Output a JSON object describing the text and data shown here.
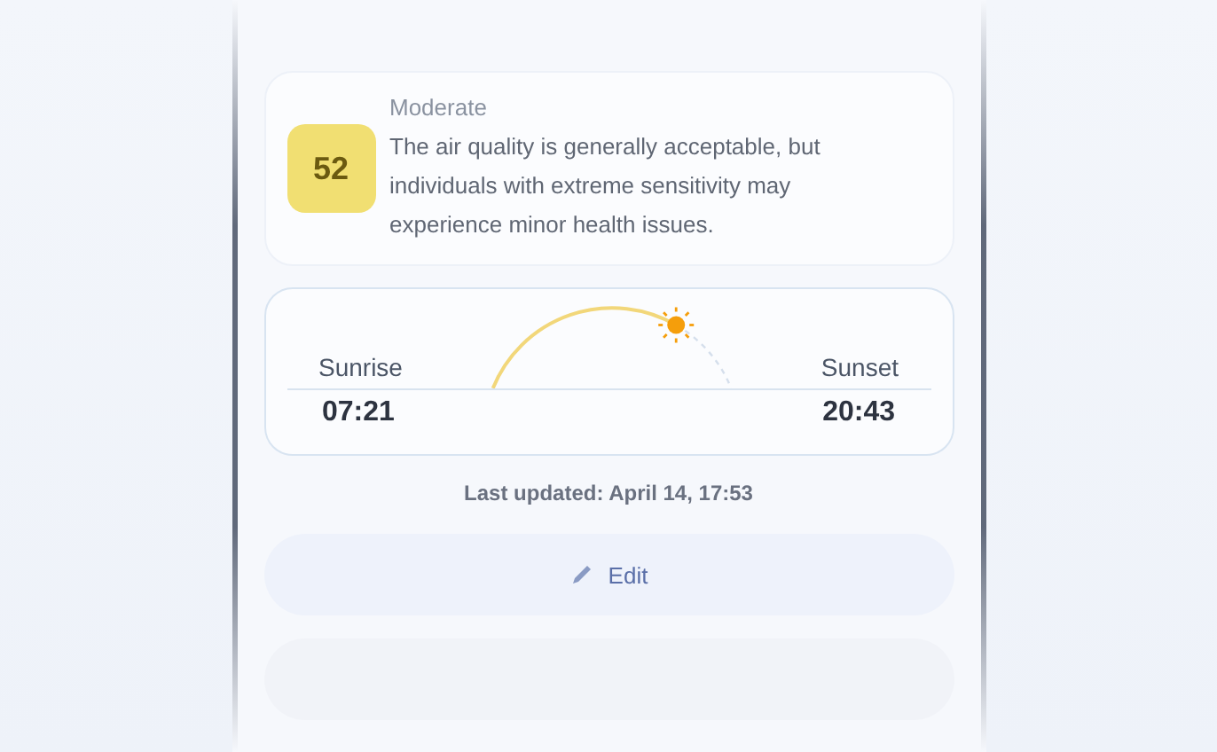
{
  "aqi": {
    "value": "52",
    "category": "Moderate",
    "description": "The air quality is generally acceptable, but individuals with extreme sensitivity may experience minor health issues."
  },
  "sun": {
    "sunrise_label": "Sunrise",
    "sunrise": "07:21",
    "sunset_label": "Sunset",
    "sunset": "20:43",
    "level": 0.72
  },
  "last_updated": "Last updated: April 14, 17:53",
  "buttons": [
    {
      "kind": "edit",
      "label": "Edit"
    },
    {
      "kind": "blank"
    }
  ]
}
